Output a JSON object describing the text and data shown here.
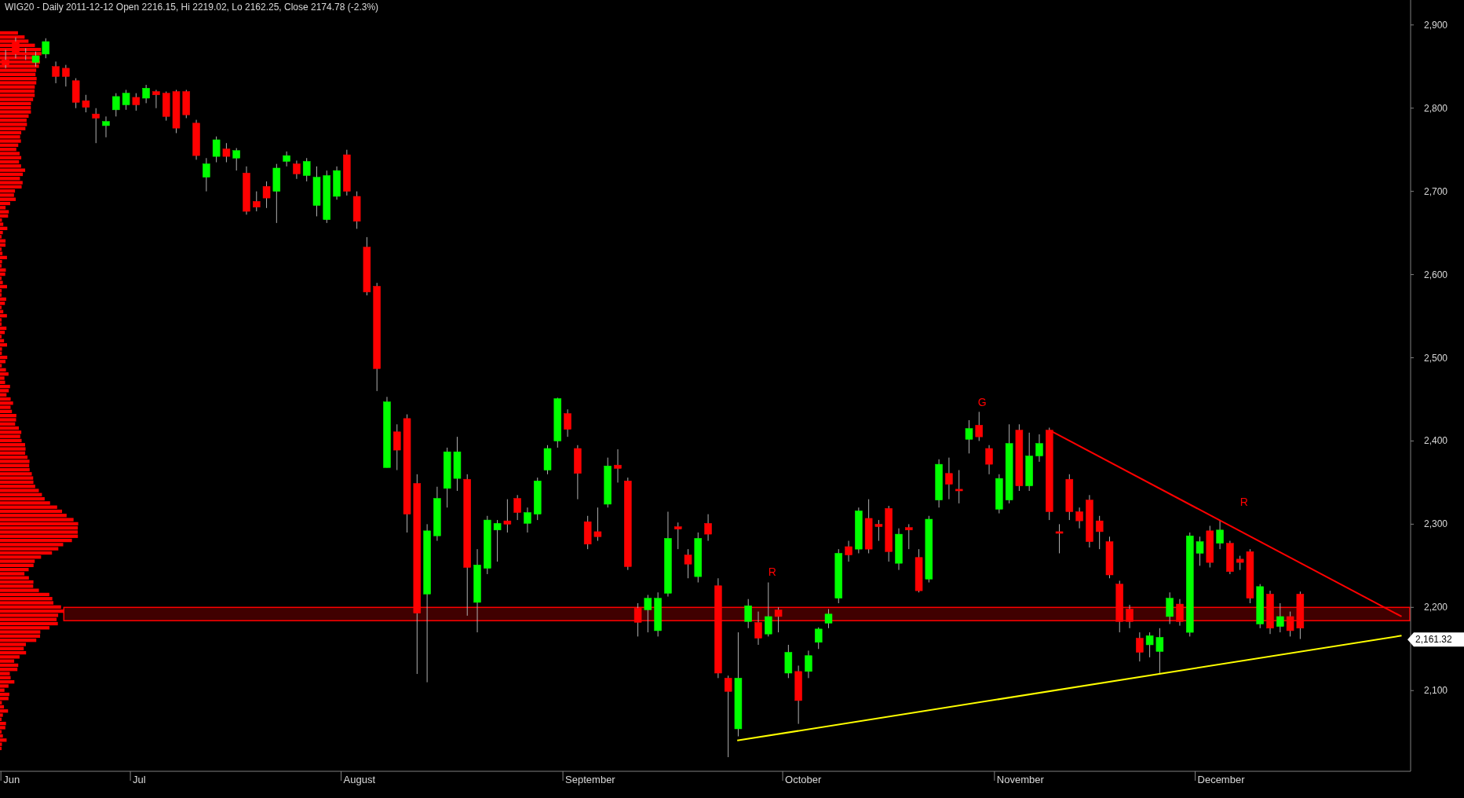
{
  "title": "WIG20 - Daily 2011-12-12 Open 2216.15, Hi 2219.02, Lo 2162.25, Close 2174.78 (-2.3%)",
  "chart": {
    "y_axis_labels": [
      "2,900",
      "2,800",
      "2,700",
      "2,600",
      "2,500",
      "2,400",
      "2,300",
      "2,200",
      "2,100"
    ],
    "month_labels": [
      "Jun",
      "Jul",
      "August",
      "September",
      "October",
      "November",
      "December"
    ],
    "trend_lines": [
      {
        "color": "#ff0000"
      },
      {
        "color": "#ffff00"
      }
    ],
    "marker_labels": [
      "R",
      "G",
      "R"
    ],
    "last_price": "2,161.32"
  }
}
